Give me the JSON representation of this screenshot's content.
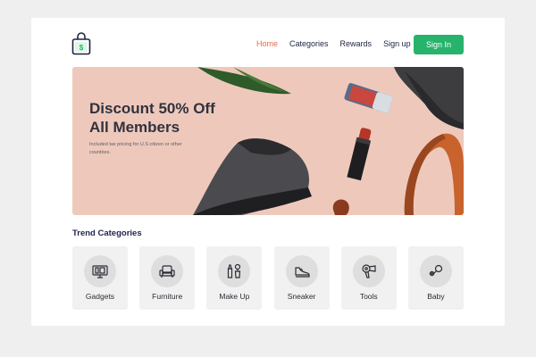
{
  "nav": {
    "items": [
      {
        "label": "Home",
        "active": true
      },
      {
        "label": "Categories",
        "active": false
      },
      {
        "label": "Rewards",
        "active": false
      },
      {
        "label": "Sign up",
        "active": false
      }
    ],
    "signin_label": "Sign In"
  },
  "banner": {
    "headline_line1": "Discount 50% Off",
    "headline_line2": "All Members",
    "subtext": "Included tax pricing for U.S citizen or other countries."
  },
  "section": {
    "title": "Trend Categories"
  },
  "categories": [
    {
      "label": "Gadgets",
      "icon": "gadgets-icon"
    },
    {
      "label": "Furniture",
      "icon": "armchair-icon"
    },
    {
      "label": "Make Up",
      "icon": "makeup-icon"
    },
    {
      "label": "Sneaker",
      "icon": "sneaker-icon"
    },
    {
      "label": "Tools",
      "icon": "hairdryer-icon"
    },
    {
      "label": "Baby",
      "icon": "pacifier-icon"
    }
  ],
  "colors": {
    "accent": "#27b36b",
    "active_nav": "#e56b4f",
    "banner_bg": "#eec9bb",
    "text_dark": "#1f2340"
  }
}
